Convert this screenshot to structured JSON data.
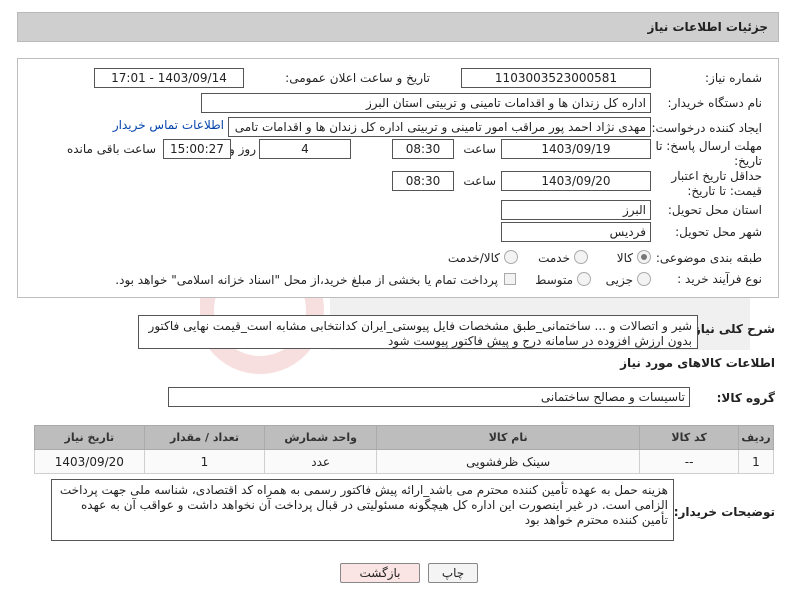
{
  "header": {
    "title": "جزئیات اطلاعات نیاز"
  },
  "form": {
    "need_number": {
      "label": "شماره نیاز:",
      "value": "1103003523000581"
    },
    "announce_datetime": {
      "label": "تاریخ و ساعت اعلان عمومی:",
      "value": "1403/09/14 - 17:01"
    },
    "buyer_org": {
      "label": "نام دستگاه خریدار:",
      "value": "اداره کل زندان ها و اقدامات تامینی و تربیتی استان البرز"
    },
    "requester": {
      "label": "ایجاد کننده درخواست:",
      "value": "مهدی نژاد احمد پور مراقب امور تامینی و تربیتی اداره کل زندان ها و اقدامات تامی",
      "contact_link": "اطلاعات تماس خریدار"
    },
    "response_deadline": {
      "label": "مهلت ارسال پاسخ: تا تاریخ:",
      "date": "1403/09/19",
      "time_label": "ساعت",
      "time": "08:30",
      "days": "4",
      "days_label": "روز و",
      "remaining": "15:00:27",
      "remaining_label": "ساعت باقی مانده"
    },
    "price_validity": {
      "label": "حداقل تاریخ اعتبار قیمت: تا تاریخ:",
      "date": "1403/09/20",
      "time_label": "ساعت",
      "time": "08:30"
    },
    "province": {
      "label": "استان محل تحویل:",
      "value": "البرز"
    },
    "city": {
      "label": "شهر محل تحویل:",
      "value": "فردیس"
    },
    "category": {
      "label": "طبقه بندی موضوعی:",
      "options": [
        "کالا",
        "خدمت",
        "کالا/خدمت"
      ],
      "selected": "کالا"
    },
    "purchase_type": {
      "label": "نوع فرآیند خرید :",
      "options": [
        "جزیی",
        "متوسط"
      ],
      "selected": "",
      "note": "پرداخت تمام یا بخشی از مبلغ خرید،از محل \"اسناد خزانه اسلامی\" خواهد بود."
    }
  },
  "description": {
    "label": "شرح کلی نیاز:",
    "value": "شیر و اتصالات و ... ساختمانی_طبق مشخصات فایل پیوستی_ایران کدانتخابی مشابه است_قیمت نهایی فاکتور بدون ارزش افزوده در سامانه درج و پیش فاکتور پیوست شود"
  },
  "goods_info": {
    "title": "اطلاعات کالاهای مورد نیاز",
    "group_label": "گروه کالا:",
    "group_value": "تاسیسات و مصالح ساختمانی"
  },
  "table": {
    "headers": [
      "ردیف",
      "کد کالا",
      "نام کالا",
      "واحد شمارش",
      "تعداد / مقدار",
      "تاریخ نیاز"
    ],
    "rows": [
      [
        "1",
        "--",
        "سینک ظرفشویی",
        "عدد",
        "1",
        "1403/09/20"
      ]
    ]
  },
  "buyer_notes": {
    "label": "توضیحات خریدار:",
    "value": "هزینه حمل به عهده تأمین کننده محترم می باشد_ارائه پیش فاکتور رسمی به همراه کد اقتصادی، شناسه ملی جهت پرداخت الزامی است. در غیر اینصورت این اداره کل هیچگونه مسئولیتی در قبال پرداخت آن نخواهد داشت و عواقب آن به عهده تأمین کننده محترم خواهد بود"
  },
  "buttons": {
    "print": "چاپ",
    "back": "بازگشت"
  },
  "colors": {
    "back_button_bg": "#fbe4e4",
    "header_bg": "#cfcfcf",
    "table_header_bg": "#bdbdbd"
  }
}
